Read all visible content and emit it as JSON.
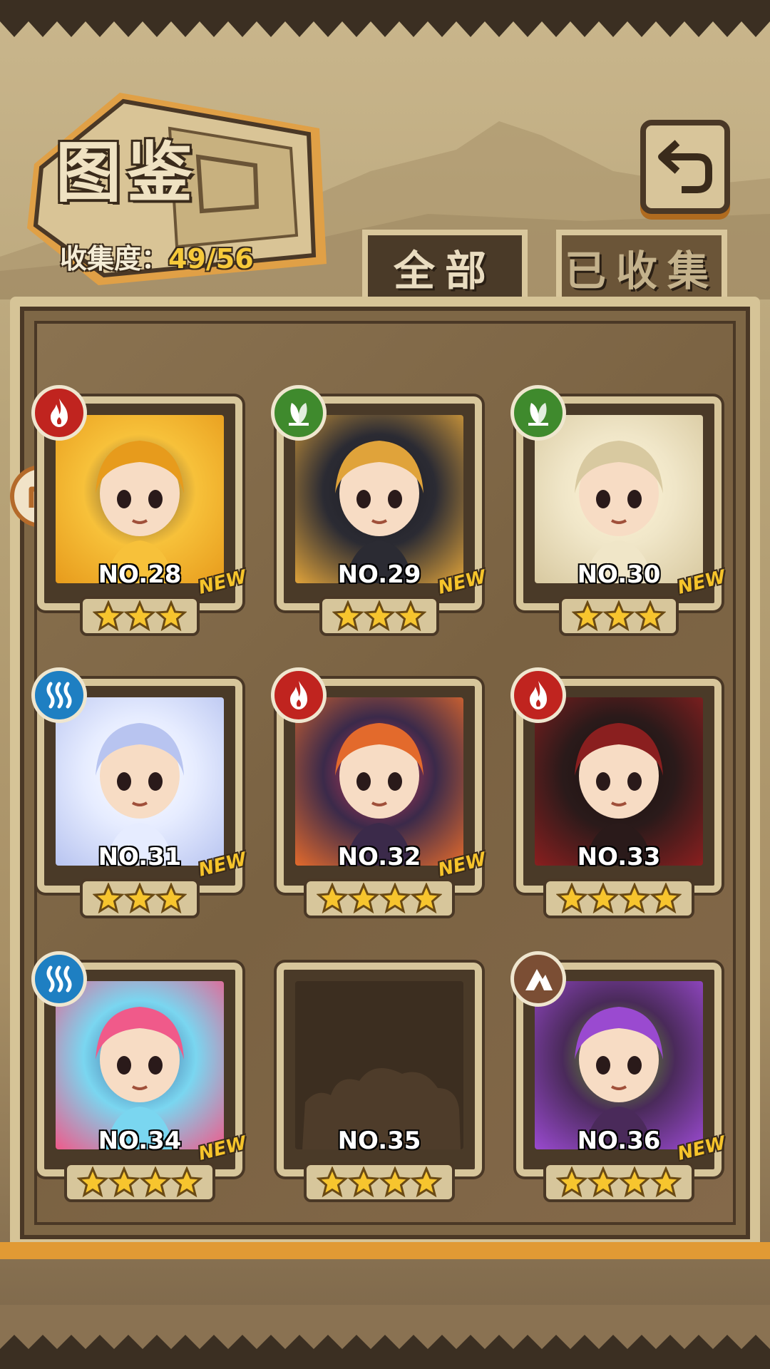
{
  "header": {
    "title": "图鉴",
    "collection_label": "收集度：",
    "collection_value": "49/56"
  },
  "back_button": {
    "icon": "return-arrow-icon"
  },
  "tabs": [
    {
      "label": "全部",
      "selected": true
    },
    {
      "label": "已收集",
      "selected": false
    }
  ],
  "colors": {
    "accent": "#e19a34",
    "fire": "#c0241f",
    "leaf": "#3f8a2d",
    "water": "#1e7fc2",
    "earth": "#7b4e34",
    "new_badge": "#f6c42b"
  },
  "cards": [
    {
      "number": "NO.28",
      "element": "fire",
      "stars": 3,
      "new": "NEW",
      "collected": true
    },
    {
      "number": "NO.29",
      "element": "leaf",
      "stars": 3,
      "new": "NEW",
      "collected": true
    },
    {
      "number": "NO.30",
      "element": "leaf",
      "stars": 3,
      "new": "NEW",
      "collected": true
    },
    {
      "number": "NO.31",
      "element": "water",
      "stars": 3,
      "new": "NEW",
      "collected": true
    },
    {
      "number": "NO.32",
      "element": "fire",
      "stars": 4,
      "new": "NEW",
      "collected": true
    },
    {
      "number": "NO.33",
      "element": "fire",
      "stars": 4,
      "new": "",
      "collected": true
    },
    {
      "number": "NO.34",
      "element": "water",
      "stars": 4,
      "new": "NEW",
      "collected": true
    },
    {
      "number": "NO.35",
      "element": "",
      "stars": 4,
      "new": "",
      "collected": false
    },
    {
      "number": "NO.36",
      "element": "earth",
      "stars": 4,
      "new": "NEW",
      "collected": true
    }
  ]
}
